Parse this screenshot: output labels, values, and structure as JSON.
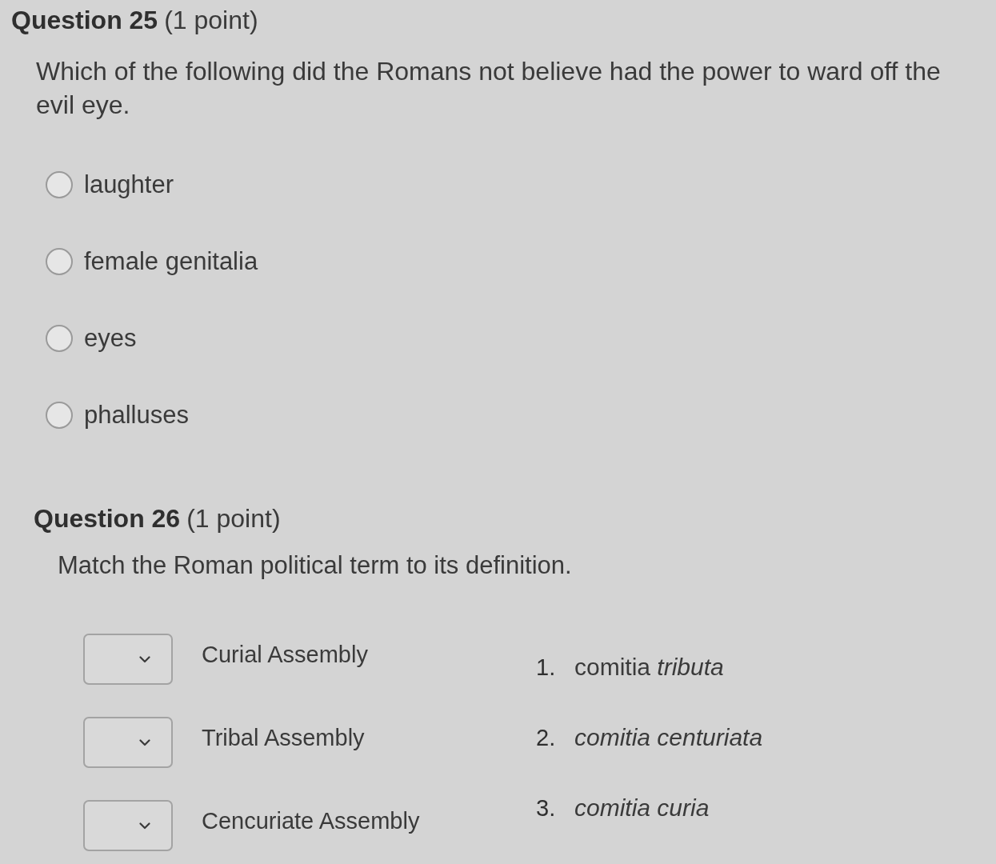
{
  "questions": [
    {
      "kind": "multiple_choice",
      "title": "Question 25",
      "points": "(1 point)",
      "prompt": "Which of the following did the Romans not believe had the power to ward off the evil eye.",
      "options": [
        {
          "label": "laughter",
          "selected": false
        },
        {
          "label": "female genitalia",
          "selected": false
        },
        {
          "label": "eyes",
          "selected": false
        },
        {
          "label": "phalluses",
          "selected": false
        }
      ]
    },
    {
      "kind": "matching",
      "title": "Question 26",
      "points": "(1 point)",
      "prompt": "Match the Roman political term to its definition.",
      "terms": [
        "Curial Assembly",
        "Tribal Assembly",
        "Cencuriate Assembly"
      ],
      "definitions": [
        {
          "number": "1.",
          "text": "comitia *tributa*",
          "italic": false
        },
        {
          "number": "2.",
          "text": "comitia centuriata",
          "italic": true
        },
        {
          "number": "3.",
          "text": "comitia curia",
          "italic": true
        }
      ]
    }
  ]
}
